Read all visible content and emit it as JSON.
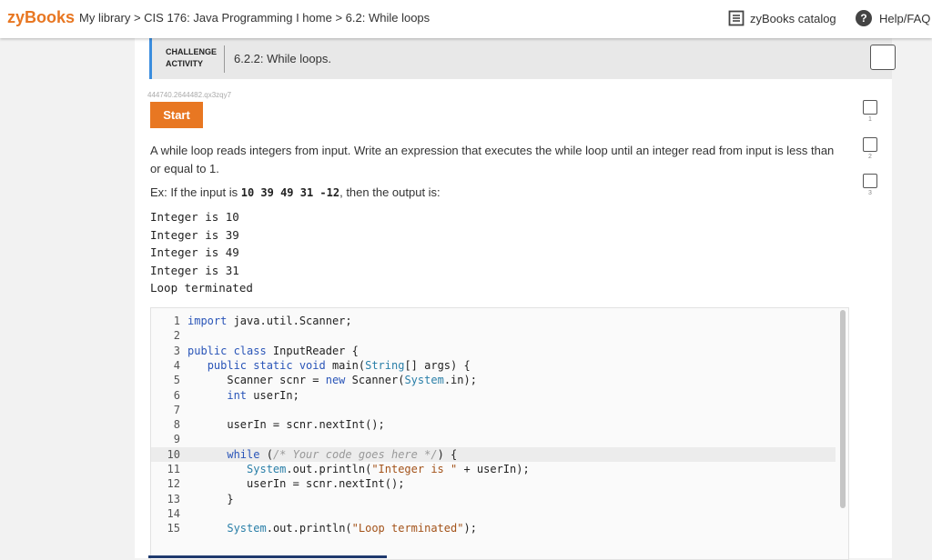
{
  "nav": {
    "logo": "zyBooks",
    "breadcrumb": [
      "My library",
      "CIS 176: Java Programming I home",
      "6.2: While loops"
    ],
    "separator": " > ",
    "catalog": "zyBooks catalog",
    "help": "Help/FAQ",
    "help_icon": "?"
  },
  "activity": {
    "label_line1": "CHALLENGE",
    "label_line2": "ACTIVITY",
    "title": "6.2.2: While loops.",
    "id": "444740.2644482.qx3zqy7",
    "start_label": "Start",
    "prompt": "A while loop reads integers from input. Write an expression that executes the while loop until an integer read from input is less than or equal to 1.",
    "example_prefix": "Ex: If the input is ",
    "example_input": "10 39 49 31 -12",
    "example_suffix": ", then the output is:",
    "output_lines": [
      "Integer is 10",
      "Integer is 39",
      "Integer is 49",
      "Integer is 31",
      "Loop terminated"
    ]
  },
  "levels": [
    "1",
    "2",
    "3"
  ],
  "code": {
    "line_numbers": [
      "1",
      "2",
      "3",
      "4",
      "5",
      "6",
      "7",
      "8",
      "9",
      "10",
      "11",
      "12",
      "13",
      "14",
      "15"
    ],
    "l1_kw": "import",
    "l1_rest": " java.util.Scanner;",
    "l3_kw": "public class",
    "l3_rest": " InputReader {",
    "l4_kw": "public static void",
    "l4_mid": " main(",
    "l4_type": "String",
    "l4_rest": "[] args) {",
    "l5_a": "Scanner scnr = ",
    "l5_kw": "new",
    "l5_b": " Scanner(",
    "l5_tk": "System",
    "l5_c": ".in);",
    "l6_kw": "int",
    "l6_rest": " userIn;",
    "l8": "userIn = scnr.nextInt();",
    "l10_kw": "while",
    "l10_open": " (",
    "l10_cm": "/* Your code goes here */",
    "l10_close": ") {",
    "l11_tk": "System",
    "l11_a": ".out.println(",
    "l11_st": "\"Integer is \"",
    "l11_b": " + userIn);",
    "l12": "userIn = scnr.nextInt();",
    "l13": "}",
    "l15_tk": "System",
    "l15_a": ".out.println(",
    "l15_st": "\"Loop terminated\"",
    "l15_b": ");"
  }
}
